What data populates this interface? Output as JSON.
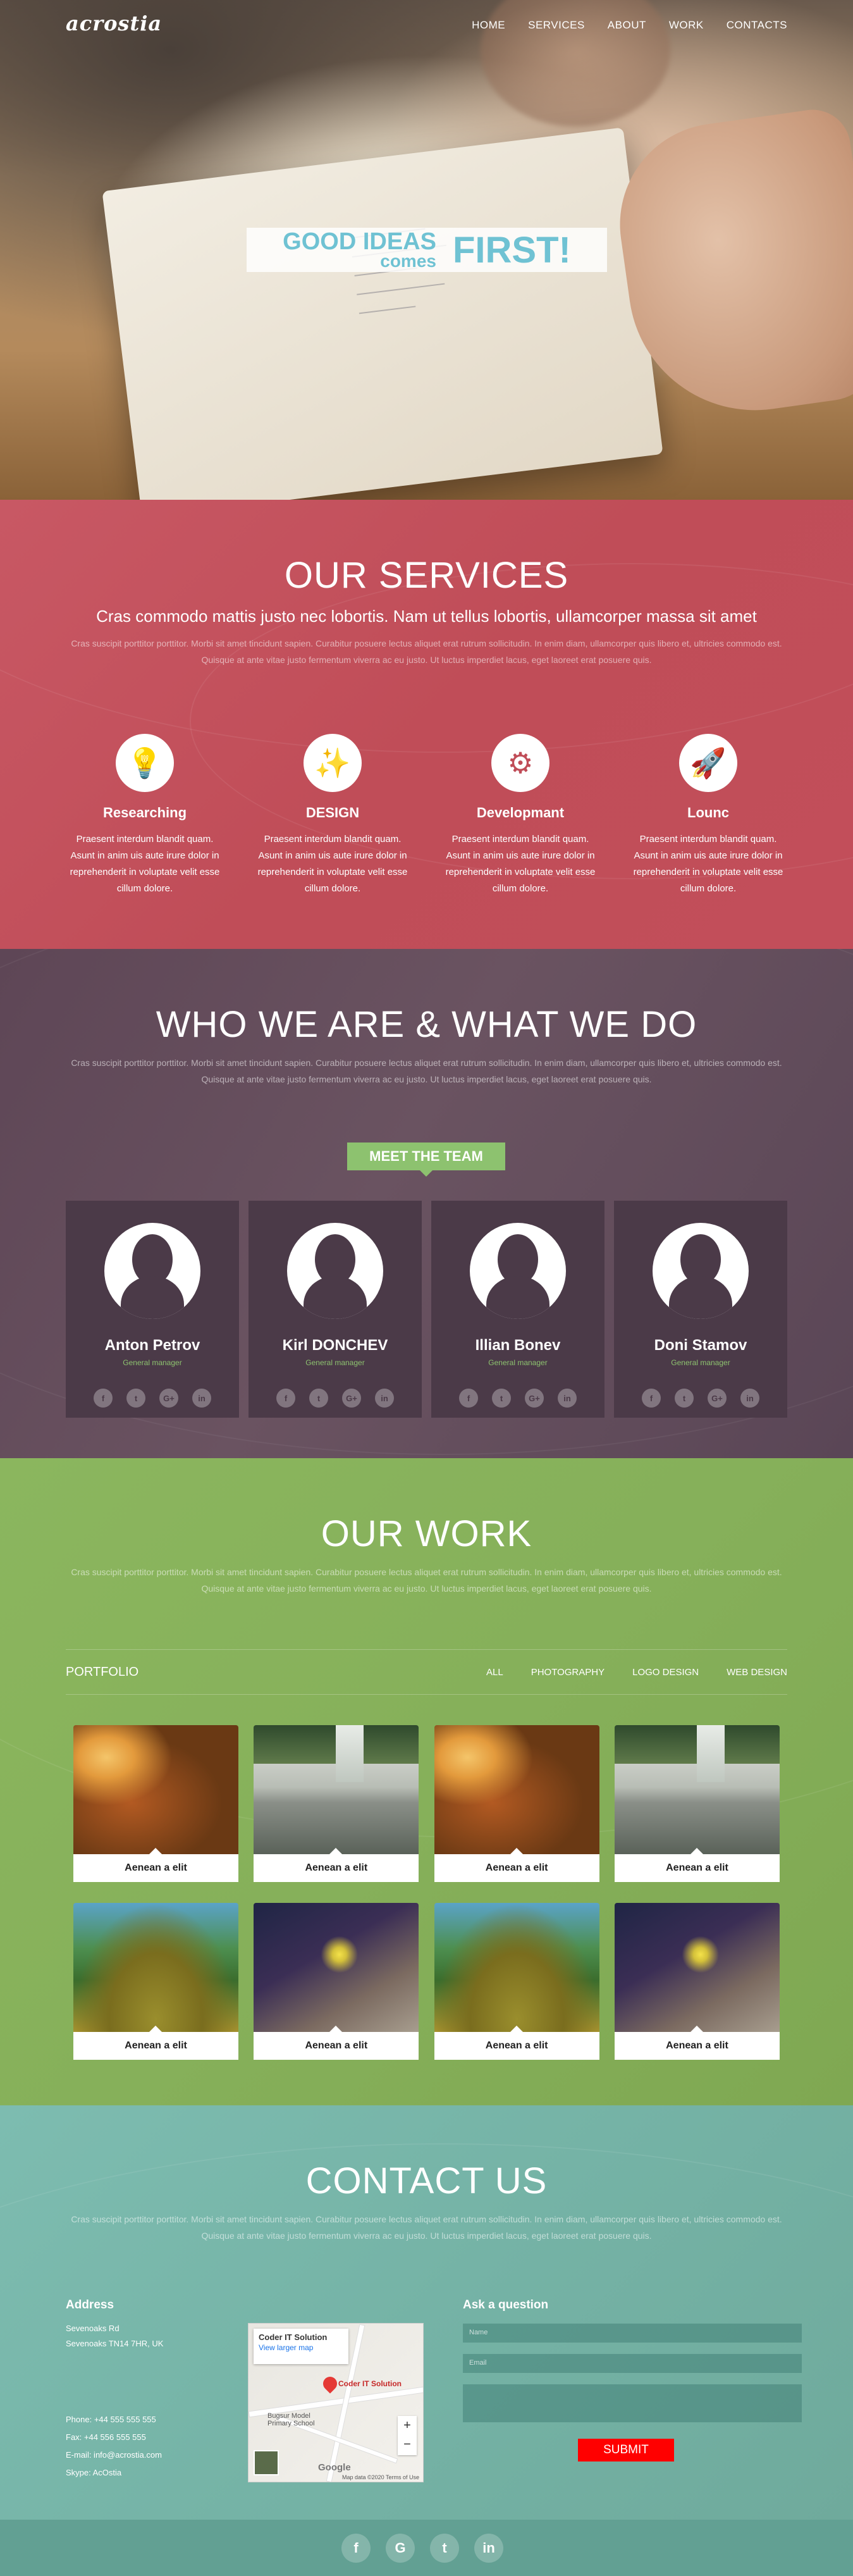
{
  "header": {
    "logo": "acrostia",
    "nav": [
      "HOME",
      "SERVICES",
      "ABOUT",
      "WORK",
      "CONTACTS"
    ]
  },
  "hero": {
    "good_ideas": "GOOD IDEAS",
    "comes": "comes",
    "first": "FIRST!"
  },
  "services": {
    "title": "OUR SERVICES",
    "lead": "Cras commodo mattis justo nec lobortis. Nam ut tellus lobortis, ullamcorper massa sit amet",
    "text": "Cras suscipit porttitor porttitor. Morbi sit amet tincidunt sapien. Curabitur posuere lectus aliquet erat rutrum sollicitudin. In enim diam, ullamcorper quis libero et, ultricies commodo est. Quisque at ante vitae justo fermentum viverra ac eu justo. Ut luctus imperdiet lacus, eget laoreet erat posuere quis.",
    "items": [
      {
        "icon": "lightbulb-icon",
        "glyph": "💡",
        "title": "Researching",
        "text": "Praesent interdum blandit quam. Asunt in anim uis aute irure dolor in reprehenderit in voluptate velit esse cillum dolore."
      },
      {
        "icon": "magic-wand-icon",
        "glyph": "✨",
        "title": "DESIGN",
        "text": "Praesent interdum blandit quam. Asunt in anim uis aute irure dolor in reprehenderit in voluptate velit esse cillum dolore."
      },
      {
        "icon": "gears-icon",
        "glyph": "⚙",
        "title": "Developmant",
        "text": "Praesent interdum blandit quam. Asunt in anim uis aute irure dolor in reprehenderit in voluptate velit esse cillum dolore."
      },
      {
        "icon": "rocket-icon",
        "glyph": "🚀",
        "title": "Lounc",
        "text": "Praesent interdum blandit quam. Asunt in anim uis aute irure dolor in reprehenderit in voluptate velit esse cillum dolore."
      }
    ]
  },
  "team": {
    "title": "WHO WE ARE & WHAT WE DO",
    "text": "Cras suscipit porttitor porttitor. Morbi sit amet tincidunt sapien. Curabitur posuere lectus aliquet erat rutrum sollicitudin. In enim diam, ullamcorper quis libero et, ultricies commodo est. Quisque at ante vitae justo fermentum viverra ac eu justo. Ut luctus imperdiet lacus, eget laoreet erat posuere quis.",
    "meet_label": "MEET THE TEAM",
    "members": [
      {
        "name": "Anton Petrov",
        "role": "General manager"
      },
      {
        "name": "Kirl DONCHEV",
        "role": "General manager"
      },
      {
        "name": "Illian Bonev",
        "role": "General manager"
      },
      {
        "name": "Doni Stamov",
        "role": "General manager"
      }
    ],
    "social": [
      "f",
      "t",
      "G+",
      "in"
    ]
  },
  "work": {
    "title": "OUR WORK",
    "text": "Cras suscipit porttitor porttitor. Morbi sit amet tincidunt sapien. Curabitur posuere lectus aliquet erat rutrum sollicitudin. In enim diam, ullamcorper quis libero et, ultricies commodo est. Quisque at ante vitae justo fermentum viverra ac eu justo. Ut luctus imperdiet lacus, eget laoreet erat posuere quis.",
    "portfolio_label": "PORTFOLIO",
    "filters": [
      "ALL",
      "PHOTOGRAPHY",
      "LOGO DESIGN",
      "WEB DESIGN"
    ],
    "items": [
      {
        "caption": "Aenean a elit",
        "image": "cactus"
      },
      {
        "caption": "Aenean a elit",
        "image": "falls"
      },
      {
        "caption": "Aenean a elit",
        "image": "cactus"
      },
      {
        "caption": "Aenean a elit",
        "image": "falls"
      },
      {
        "caption": "Aenean a elit",
        "image": "mossy"
      },
      {
        "caption": "Aenean a elit",
        "image": "flower"
      },
      {
        "caption": "Aenean a elit",
        "image": "mossy"
      },
      {
        "caption": "Aenean a elit",
        "image": "flower"
      }
    ]
  },
  "contact": {
    "title": "CONTACT US",
    "text": "Cras suscipit porttitor porttitor. Morbi sit amet tincidunt sapien. Curabitur posuere lectus aliquet erat rutrum sollicitudin. In enim diam, ullamcorper quis libero et, ultricies commodo est. Quisque at ante vitae justo fermentum viverra ac eu justo. Ut luctus imperdiet lacus, eget laoreet erat posuere quis.",
    "address_title": "Address",
    "address_line1": "Sevenoaks Rd",
    "address_line2": "Sevenoaks TN14 7HR, UK",
    "phone": "Phone: +44 555 555 555",
    "fax": "Fax: +44 556 555 555",
    "email": "E-mail: info@acrostia.com",
    "skype": "Skype: AcOstia",
    "map": {
      "place": "Coder IT Solution",
      "link": "View larger map",
      "pin_label": "Coder IT Solution",
      "school_label": "Bugsur Model Primary School",
      "logo": "Google",
      "terms": "Map data ©2020  Terms of Use",
      "zoom_in": "+",
      "zoom_out": "−"
    },
    "ask_title": "Ask a question",
    "name_placeholder": "Name",
    "email_placeholder": "Email",
    "submit_label": "SUBMIT"
  },
  "footer": {
    "social": [
      "f",
      "G",
      "t",
      "in"
    ]
  },
  "colors": {
    "services_bg": "#c04d58",
    "team_bg": "#5e4656",
    "work_bg": "#86b05a",
    "contact_bg": "#75b3a6",
    "accent_green": "#8dc26f",
    "hero_text": "#6fc2d3",
    "submit": "#ff0000"
  }
}
